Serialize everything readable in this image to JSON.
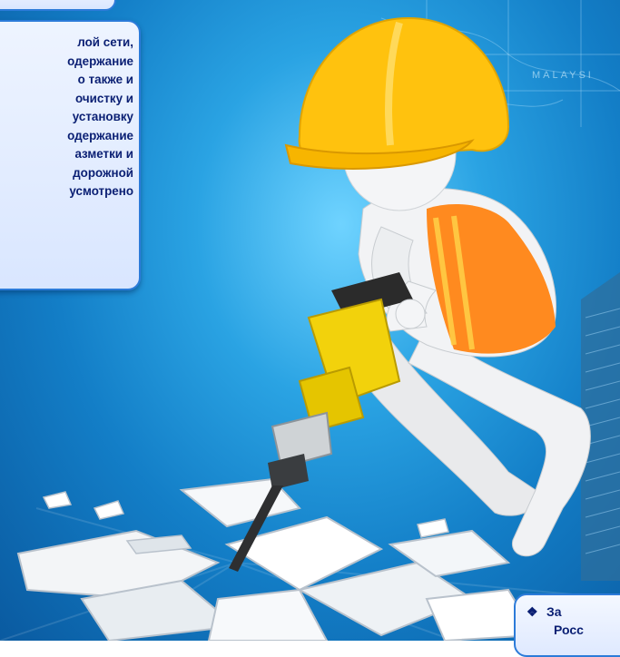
{
  "text_panel": {
    "lines": [
      "лой    сети,",
      "одержание",
      "о  также  и",
      "очистку  и",
      "установку",
      "одержание",
      "азметки  и",
      "дорожной",
      "усмотрено"
    ]
  },
  "note_panel": {
    "bullet": "❖",
    "line1": "За",
    "line2": "Росс"
  },
  "map_label": "MALAYSI",
  "colors": {
    "panel_border": "#2c7bd9",
    "panel_text": "#0a1f73",
    "helmet": "#ffc20e",
    "vest": "#ff8a1f",
    "jackhammer": "#f2d20c"
  }
}
